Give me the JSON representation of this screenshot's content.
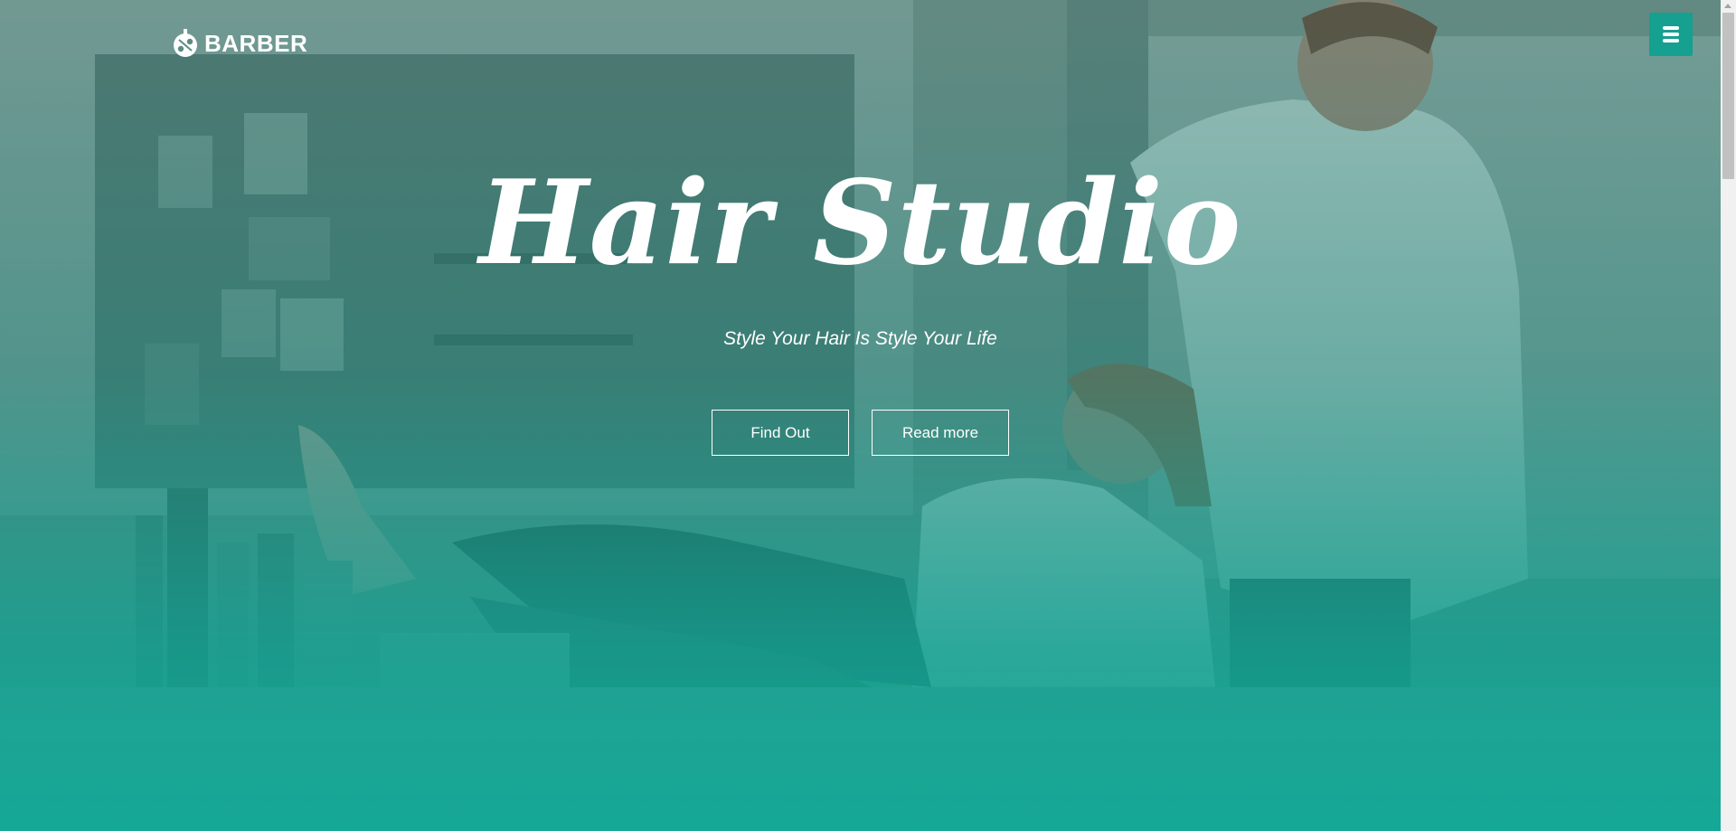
{
  "brand": {
    "name": "BARBER",
    "logo_icon": "barber-scissors-logo-icon"
  },
  "nav": {
    "menu_icon": "hamburger-menu-icon"
  },
  "hero": {
    "title": "Hair Studio",
    "subtitle": "Style Your Hair Is Style Your Life",
    "primary_button": "Find Out",
    "secondary_button": "Read more"
  },
  "colors": {
    "accent": "#16a090",
    "overlay": "#10a896",
    "text": "#ffffff"
  }
}
